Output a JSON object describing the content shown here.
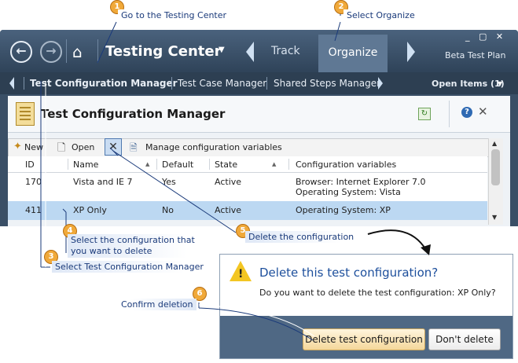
{
  "callouts": [
    {
      "num": "1",
      "text": "Go to the Testing Center"
    },
    {
      "num": "2",
      "text": "Select Organize"
    },
    {
      "num": "3",
      "text": "Select Test Configuration Manager"
    },
    {
      "num": "4",
      "text": "Select the configuration that you want to delete"
    },
    {
      "num": "5",
      "text": "Delete the configuration"
    },
    {
      "num": "6",
      "text": "Confirm deletion"
    }
  ],
  "topbar": {
    "title": "Testing Center",
    "track": "Track",
    "organize": "Organize",
    "plan": "Beta Test Plan",
    "window_controls": "_ ▢ ✕"
  },
  "subbar": {
    "items": [
      "Test Configuration Manager",
      "Test Case Manager",
      "Shared Steps Manager"
    ],
    "open_items": "Open Items (1)"
  },
  "panel": {
    "title": "Test Configuration Manager",
    "toolbar": {
      "new": "New",
      "open": "Open",
      "manage": "Manage configuration variables"
    },
    "columns": [
      "ID",
      "Name",
      "Default",
      "State",
      "Configuration variables"
    ],
    "rows": [
      {
        "id": "170",
        "name": "Vista and IE 7",
        "default": "Yes",
        "state": "Active",
        "vars1": "Browser: Internet Explorer 7.0",
        "vars2": "Operating System: Vista"
      },
      {
        "id": "411",
        "name": "XP Only",
        "default": "No",
        "state": "Active",
        "vars1": "Operating System: XP",
        "vars2": ""
      }
    ]
  },
  "dialog": {
    "title": "Delete this test configuration?",
    "message": "Do you want to delete the test configuration: XP Only?",
    "confirm": "Delete test configuration",
    "cancel": "Don't delete"
  },
  "colors": {
    "frame": "#3a4f66",
    "selected_row": "#bcd8f2",
    "callout": "#f0a93a"
  }
}
